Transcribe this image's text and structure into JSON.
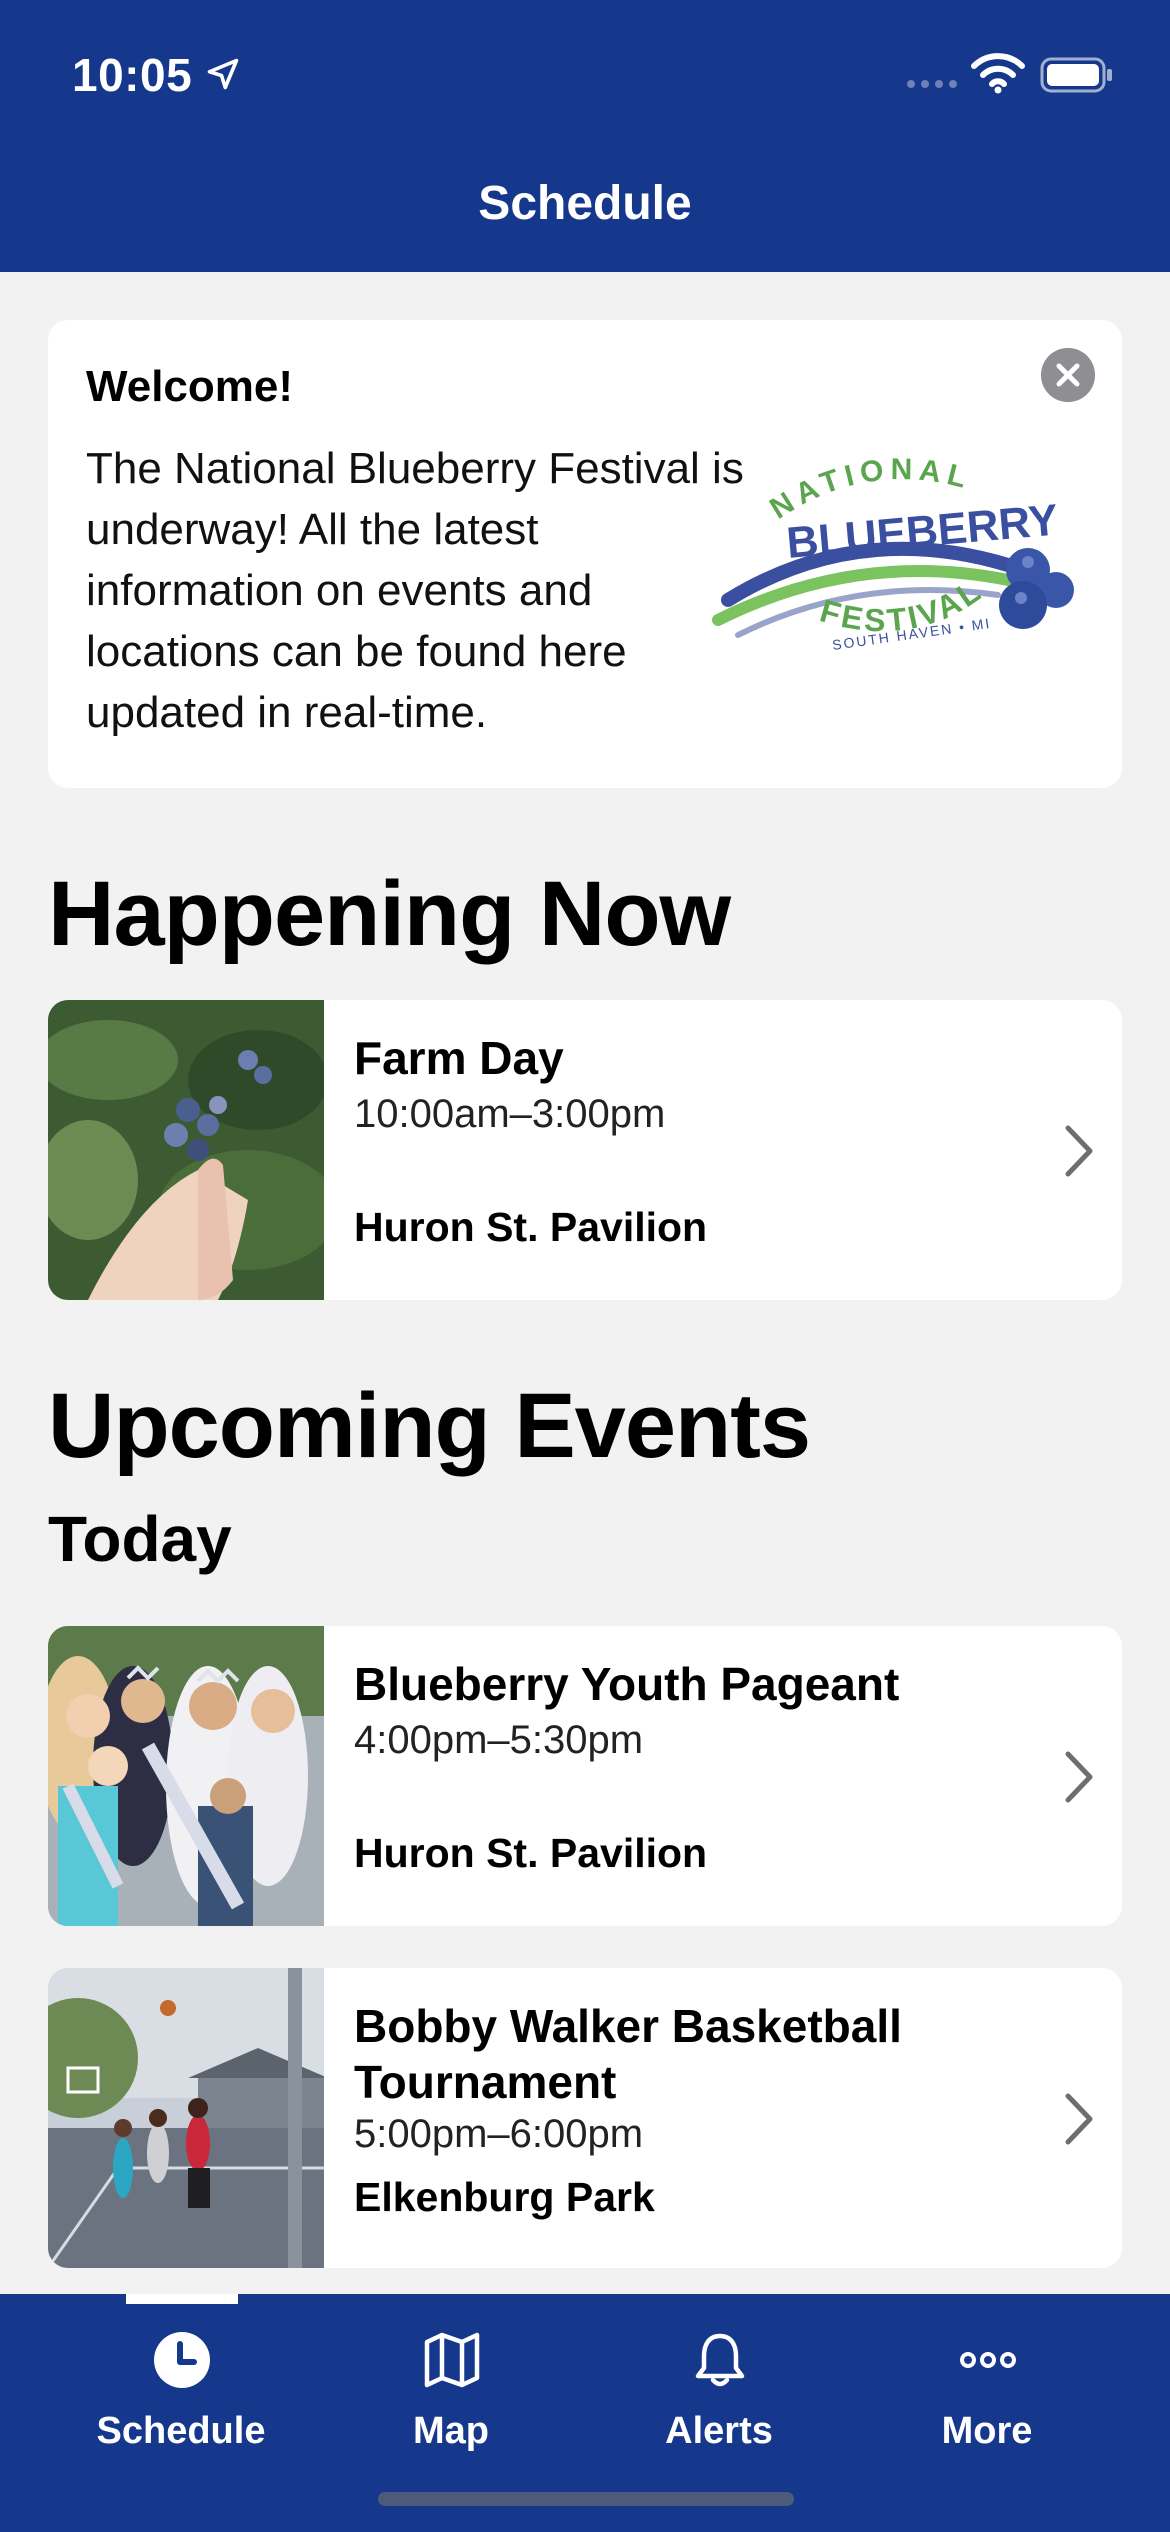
{
  "status_bar": {
    "time": "10:05"
  },
  "header": {
    "title": "Schedule"
  },
  "welcome": {
    "title": "Welcome!",
    "body": "The National Blueberry Festival is underway! All the latest information on events and locations can be found here updated in real-time.",
    "logo": {
      "arc_text": "NATIONAL",
      "main_text": "BLUEBERRY",
      "sub_text": "FESTIVAL",
      "location_text": "SOUTH HAVEN • MI"
    }
  },
  "sections": {
    "happening_now": "Happening Now",
    "upcoming_events": "Upcoming Events",
    "today": "Today"
  },
  "events": {
    "now": [
      {
        "name": "Farm Day",
        "time": "10:00am–3:00pm",
        "place": "Huron St. Pavilion"
      }
    ],
    "today": [
      {
        "name": "Blueberry Youth Pageant",
        "time": "4:00pm–5:30pm",
        "place": "Huron St. Pavilion"
      },
      {
        "name": "Bobby Walker Basketball Tournament",
        "time": "5:00pm–6:00pm",
        "place": "Elkenburg Park"
      }
    ]
  },
  "tab_bar": {
    "tabs": [
      {
        "label": "Schedule",
        "icon": "clock-icon",
        "selected": true
      },
      {
        "label": "Map",
        "icon": "map-icon",
        "selected": false
      },
      {
        "label": "Alerts",
        "icon": "bell-icon",
        "selected": false
      },
      {
        "label": "More",
        "icon": "more-icon",
        "selected": false
      }
    ]
  },
  "colors": {
    "brand_navy": "#15378c",
    "background": "#f2f2f2",
    "card": "#ffffff"
  }
}
